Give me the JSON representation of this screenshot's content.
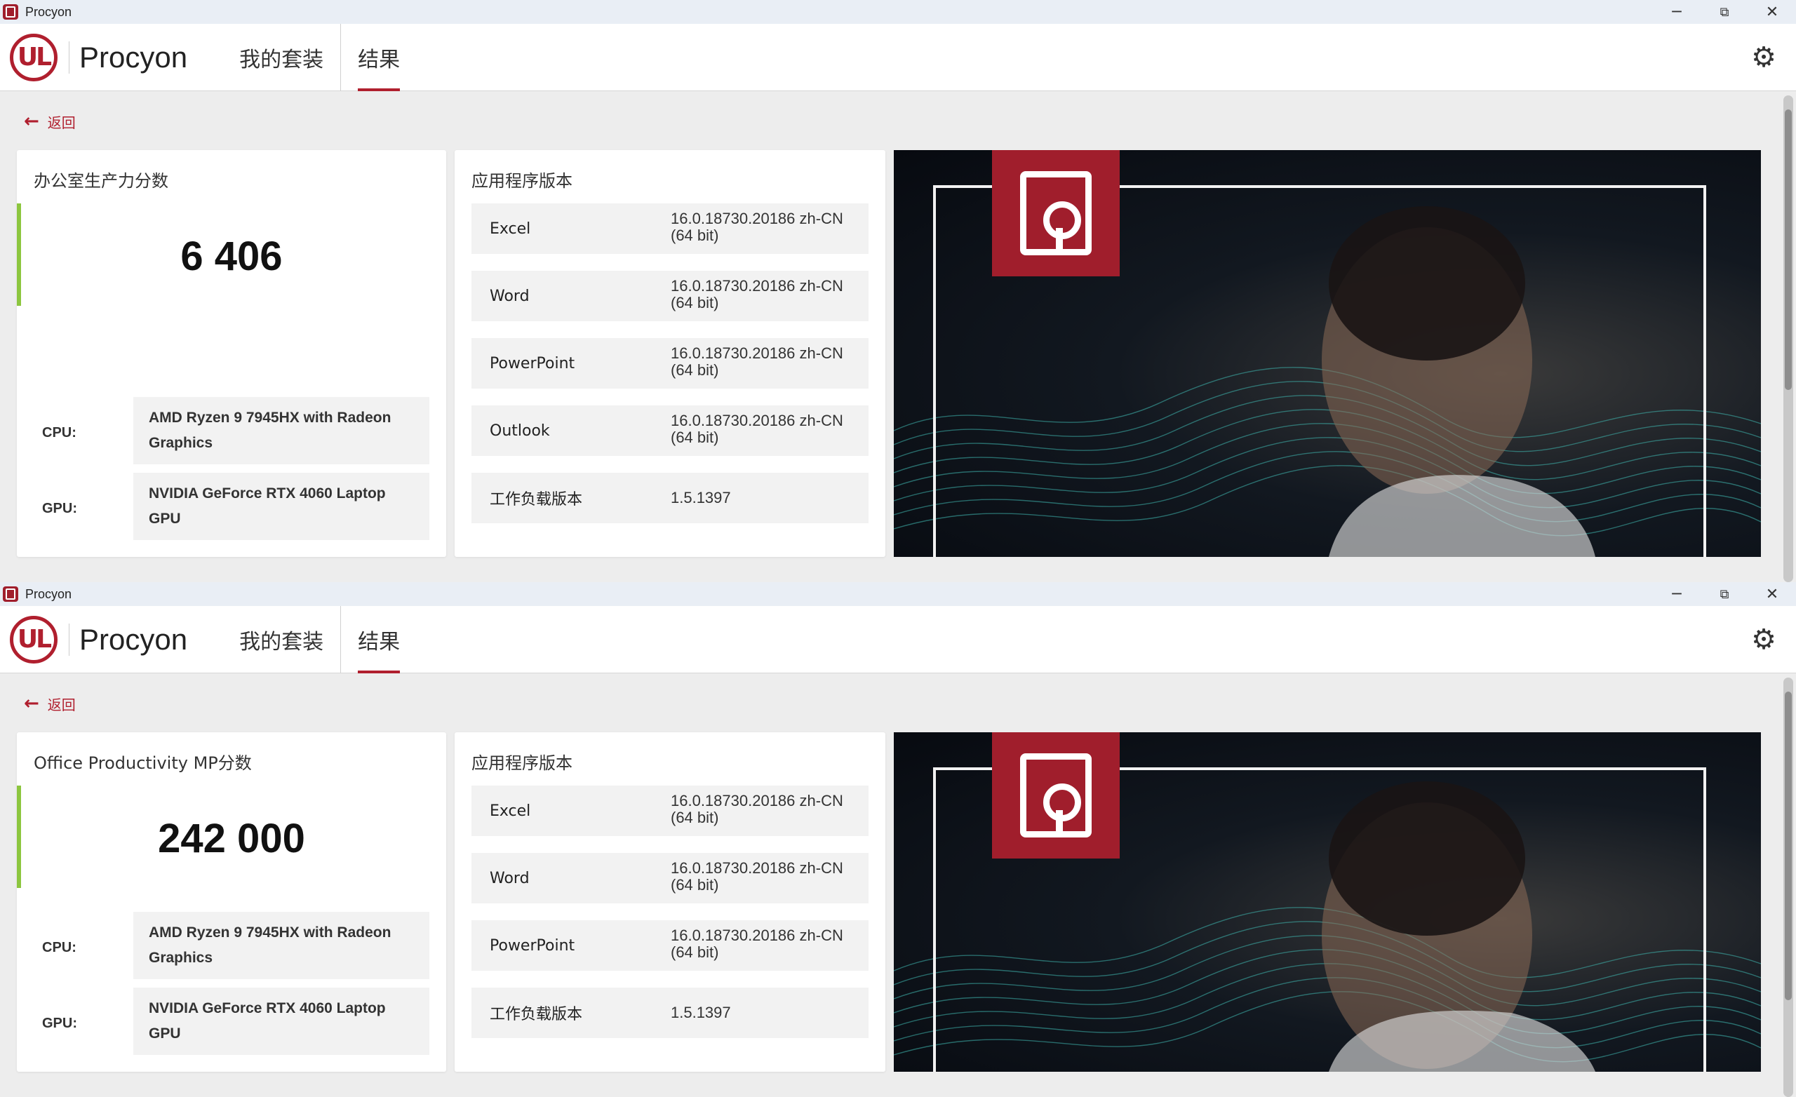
{
  "windows": [
    {
      "title": "Procyon",
      "app_name": "Procyon",
      "logo_text": "UL",
      "nav": [
        "我的套装",
        "结果"
      ],
      "back_label": "返回",
      "score_title": "办公室生产力分数",
      "score_value": "6 406",
      "cpu_label": "CPU:",
      "cpu_value": "AMD Ryzen 9 7945HX with Radeon Graphics",
      "gpu_label": "GPU:",
      "gpu_value": "NVIDIA GeForce RTX 4060 Laptop GPU",
      "versions_title": "应用程序版本",
      "versions": [
        {
          "name": "Excel",
          "value": "16.0.18730.20186 zh-CN (64 bit)"
        },
        {
          "name": "Word",
          "value": "16.0.18730.20186 zh-CN (64 bit)"
        },
        {
          "name": "PowerPoint",
          "value": "16.0.18730.20186 zh-CN (64 bit)"
        },
        {
          "name": "Outlook",
          "value": "16.0.18730.20186 zh-CN (64 bit)"
        },
        {
          "name": "工作负载版本",
          "value": "1.5.1397"
        }
      ]
    },
    {
      "title": "Procyon",
      "app_name": "Procyon",
      "logo_text": "UL",
      "nav": [
        "我的套装",
        "结果"
      ],
      "back_label": "返回",
      "score_title": "Office Productivity MP分数",
      "score_value": "242 000",
      "cpu_label": "CPU:",
      "cpu_value": "AMD Ryzen 9 7945HX with Radeon Graphics",
      "gpu_label": "GPU:",
      "gpu_value": "NVIDIA GeForce RTX 4060 Laptop GPU",
      "versions_title": "应用程序版本",
      "versions": [
        {
          "name": "Excel",
          "value": "16.0.18730.20186 zh-CN (64 bit)"
        },
        {
          "name": "Word",
          "value": "16.0.18730.20186 zh-CN (64 bit)"
        },
        {
          "name": "PowerPoint",
          "value": "16.0.18730.20186 zh-CN (64 bit)"
        },
        {
          "name": "工作负载版本",
          "value": "1.5.1397"
        }
      ]
    }
  ],
  "icons": {
    "minimize": "minimize-icon",
    "maximize": "maximize-icon",
    "close": "close-icon",
    "settings": "gear-icon",
    "back": "arrow-left-icon"
  },
  "colors": {
    "brand": "#b01f2e",
    "score_accent": "#8cc63f"
  }
}
